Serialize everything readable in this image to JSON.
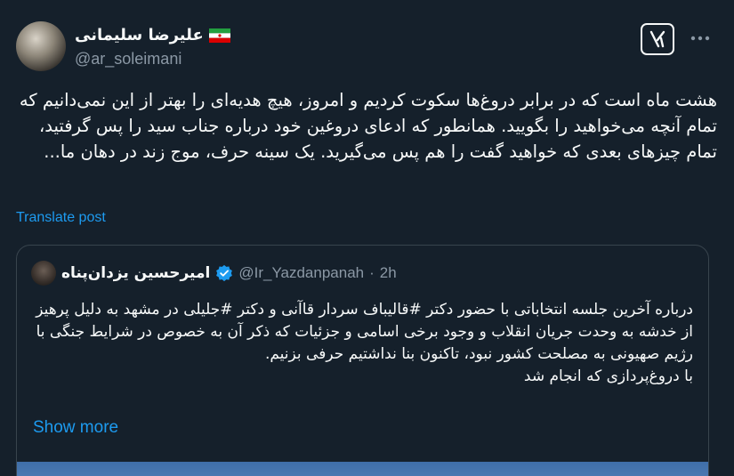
{
  "tweet": {
    "author_name": "علیرضا سلیمانی",
    "author_handle": "@ar_soleimani",
    "text": "هشت ماه است که در برابر دروغ‌ها سکوت کردیم و امروز، هیچ هدیه‌ای را بهتر از این نمی‌دانیم که تمام آنچه می‌خواهید را بگویید. همانطور که ادعای دروغین خود درباره جناب سید را پس گرفتید، تمام چیزهای بعدی که خواهید گفت را هم پس می‌گیرید. یک سینه حرف، موج زند در دهان ما...",
    "translate_label": "Translate post",
    "icons": {
      "flag": "iran-flag-icon",
      "grok": "grok-icon",
      "more": "more-icon"
    }
  },
  "quote": {
    "author_name": "امیرحسین یزدان‌پناه",
    "handle": "@Ir_Yazdanpanah",
    "separator": "·",
    "time": "2h",
    "text": "درباره آخرین جلسه انتخاباتی با حضور دکتر #قالیباف سردار قاآنی و دکتر #جلیلی در مشهد به دلیل پرهیز از خدشه به وحدت جریان انقلاب و وجود برخی اسامی و جزئیات که ذکر آن به خصوص در شرایط جنگی با رژیم صهیونی به مصلحت کشور نبود، تاکنون بنا نداشتیم حرفی بزنیم.\nبا دروغ‌پردازی که انجام شد",
    "show_more_label": "Show more",
    "icons": {
      "verified": "verified-badge-icon"
    }
  },
  "colors": {
    "background": "#15202b",
    "text": "#f7f9f9",
    "secondary_text": "#8b98a5",
    "link": "#1d9bf0",
    "border": "#38444d"
  }
}
